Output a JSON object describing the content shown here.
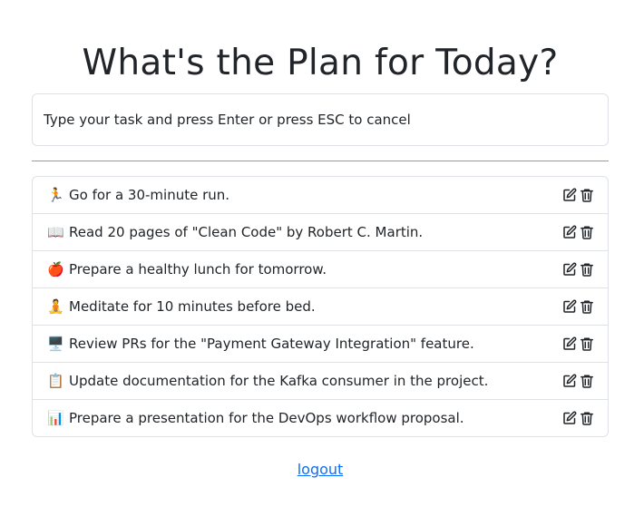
{
  "header": {
    "title": "What's the Plan for Today?"
  },
  "task_input": {
    "placeholder": "Type your task and press Enter or press ESC to cancel",
    "value": ""
  },
  "tasks": [
    {
      "emoji": "🏃",
      "text": "Go for a 30-minute run."
    },
    {
      "emoji": "📖",
      "text": "Read 20 pages of \"Clean Code\" by Robert C. Martin."
    },
    {
      "emoji": "🍎",
      "text": "Prepare a healthy lunch for tomorrow."
    },
    {
      "emoji": "🧘",
      "text": "Meditate for 10 minutes before bed."
    },
    {
      "emoji": "🖥️",
      "text": "Review PRs for the \"Payment Gateway Integration\" feature."
    },
    {
      "emoji": "📋",
      "text": "Update documentation for the Kafka consumer in the project."
    },
    {
      "emoji": "📊",
      "text": "Prepare a presentation for the DevOps workflow proposal."
    }
  ],
  "actions": {
    "edit_icon": "edit-icon",
    "delete_icon": "trash-icon"
  },
  "footer": {
    "logout_label": "logout",
    "link_color": "#0d6efd"
  }
}
